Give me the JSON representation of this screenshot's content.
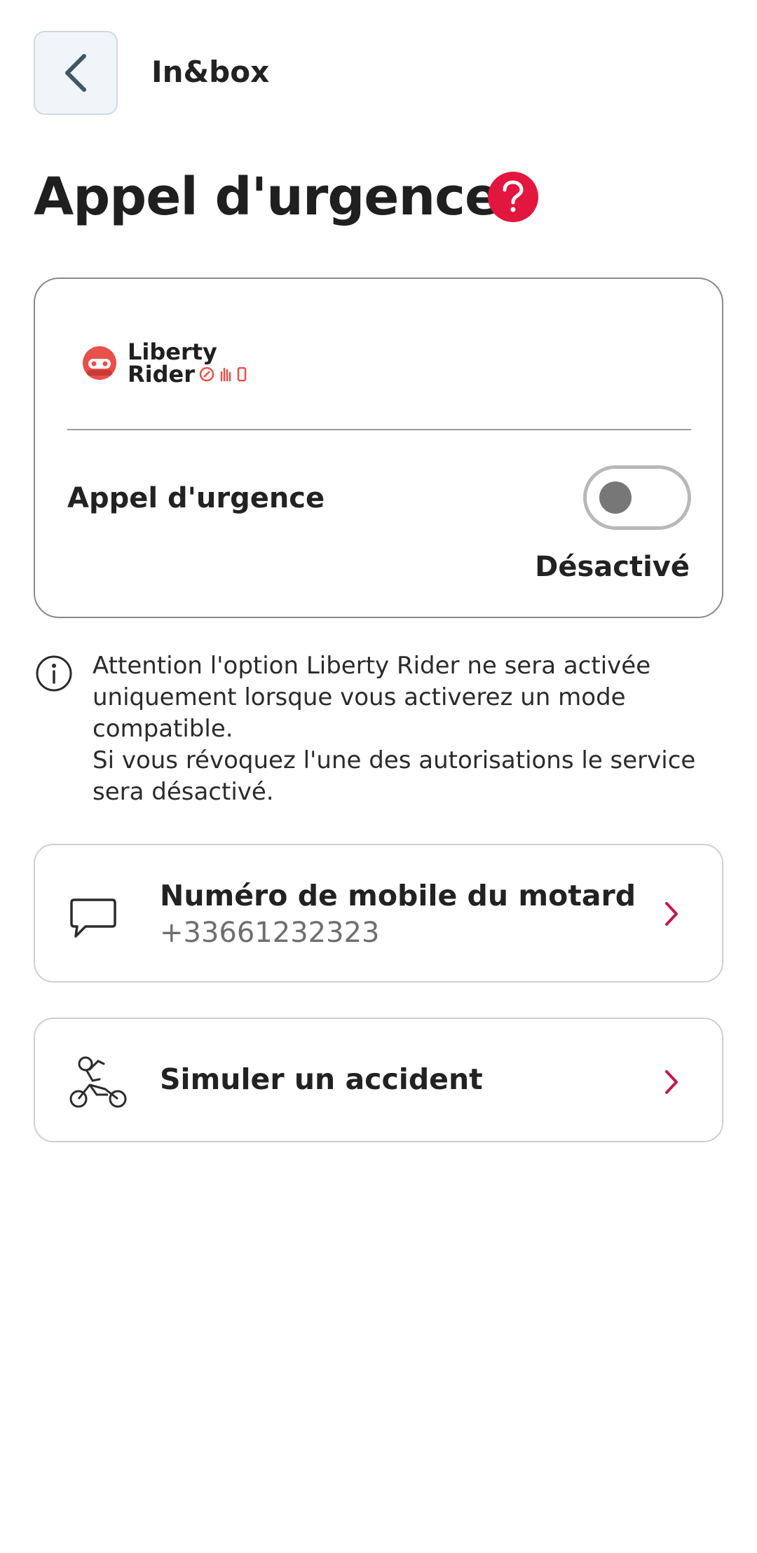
{
  "header": {
    "back_label": "",
    "title": "In&box"
  },
  "page": {
    "title": "Appel d'urgence"
  },
  "card": {
    "logo_line1": "Liberty",
    "logo_line2": "Rider",
    "toggle_label": "Appel d'urgence",
    "toggle_status": "Désactivé",
    "toggle_on": false
  },
  "info": {
    "line1": "Attention l'option Liberty Rider ne sera activée",
    "line2": "uniquement lorsque vous activerez un mode",
    "line3": "compatible.",
    "line4": "Si vous révoquez l'une des autorisations le service",
    "line5": "sera désactivé."
  },
  "phone_card": {
    "title": "Numéro de mobile du motard",
    "value": "+33661232323"
  },
  "simulate_card": {
    "title": "Simuler un accident"
  },
  "colors": {
    "accent": "#e2163f",
    "chevron": "#c2184b",
    "text": "#222222"
  },
  "icons": {
    "back": "chevron-left-icon",
    "help": "question-icon",
    "info": "info-icon",
    "phone": "chat-bubble-icon",
    "simulate": "motorbike-crash-icon",
    "chevron": "chevron-right-icon"
  }
}
